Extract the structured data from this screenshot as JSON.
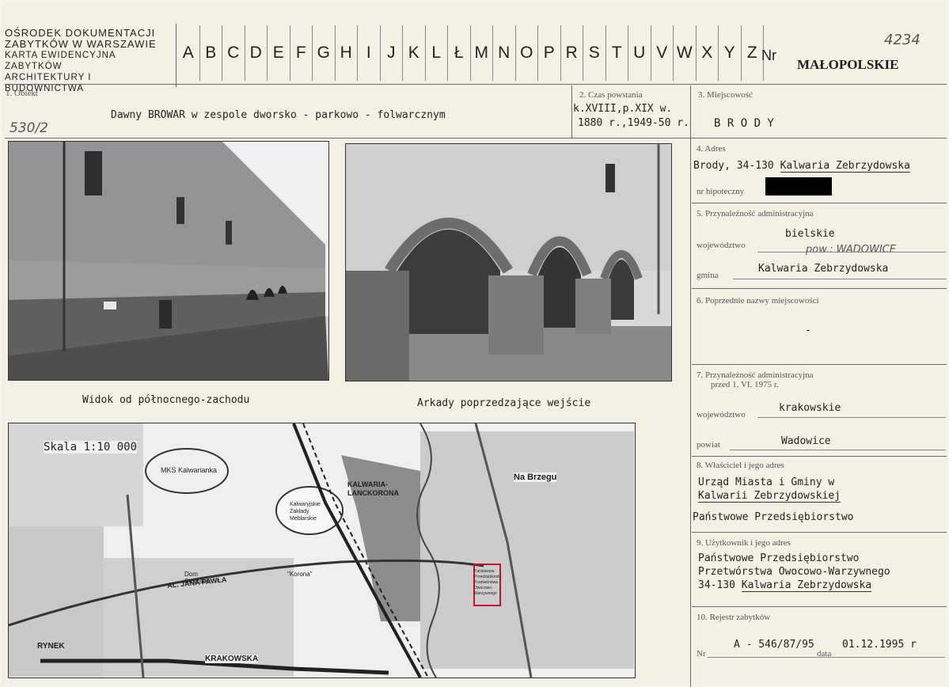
{
  "header": {
    "institution_lines": [
      "OŚRODEK DOKUMENTACJI",
      "ZABYTKÓW W WARSZAWIE",
      "KARTA EWIDENCYJNA ZABYTKÓW",
      "ARCHITEKTURY I BUDOWNICTWA"
    ],
    "letters": [
      "A",
      "B",
      "C",
      "D",
      "E",
      "F",
      "G",
      "H",
      "I",
      "J",
      "K",
      "L",
      "Ł",
      "M",
      "N",
      "O",
      "P",
      "R",
      "S",
      "T",
      "U",
      "V",
      "W",
      "X",
      "Y",
      "Z"
    ],
    "nr_label": "Nr",
    "nr_value": "4234",
    "region": "MAŁOPOLSKIE"
  },
  "object": {
    "label": "1. Obiekt",
    "value": "Dawny BROWAR w zespole dworsko - parkowo - folwarcznym",
    "hand_note": "530/2"
  },
  "time": {
    "label": "2. Czas powstania",
    "line1": "k.XVIII,p.XIX w.",
    "line2": "1880 r.,1949-50 r."
  },
  "place": {
    "label": "3. Miejscowość",
    "value": "B R O D Y"
  },
  "address": {
    "label": "4. Adres",
    "value_prefix": "Brody, 34-130 ",
    "value_underlined": "Kalwaria Zebrzydowska",
    "hipoteczny_label": "nr hipoteczny"
  },
  "admin": {
    "label": "5. Przynależność administracyjna",
    "woj_label": "województwo",
    "woj_value": "bielskie",
    "hand_note": "pow.: WADOWICE",
    "gmina_label": "gmina",
    "gmina_value": "Kalwaria Zebrzydowska"
  },
  "prev_names": {
    "label": "6. Poprzednie nazwy miejscowości",
    "value": "-"
  },
  "admin_before": {
    "label_line1": "7. Przynależność administracyjna",
    "label_line2": "przed 1. VI. 1975 r.",
    "woj_label": "województwo",
    "woj_value": "krakowskie",
    "powiat_label": "powiat",
    "powiat_value": "Wadowice"
  },
  "owner": {
    "label": "8. Właściciel i jego adres",
    "line1": "Urząd Miasta i Gminy w",
    "line2": "Kalwarii Zebrzydowskiej",
    "line3": "Państwowe Przedsiębiorstwo"
  },
  "user": {
    "label": "9. Użytkownik i jego adres",
    "line1": "Państwowe Przedsiębiorstwo",
    "line2": "Przetwórstwa Owocowo-Warzywnego",
    "line3_prefix": "34-130 ",
    "line3_underlined": "Kalwaria Zebrzydowska"
  },
  "register": {
    "label": "10. Rejestr zabytków",
    "nr_label": "Nr",
    "nr_value": "A - 546/87/95",
    "data_label": "data",
    "date_value": "01.12.1995 r"
  },
  "photos": {
    "caption_left": "Widok od północnego-zachodu",
    "caption_right": "Arkady poprzedzające wejście"
  },
  "map": {
    "scale": "Skala 1:10 000",
    "labels": {
      "kalwarianka": "MKS Kalwarianka",
      "station": "KALWARIA-LANCKORONA",
      "na_brzegu": "Na Brzegu",
      "zaklady": "Kalwaryjskie Zakłady Meblarskie",
      "street_jana_pawla": "AL. JANA PAWŁA",
      "street_krakowska": "KRAKOWSKA",
      "rynek": "RYNEK",
      "korona": "\"Korona\"",
      "dom_strazacki": "Dom Strażacki",
      "przedsiebiorstwo": "Państwowe Przedsiębiorstwo Przetwórstwa Owocowo-Warzywnego"
    }
  },
  "colors": {
    "card": "#f3f1e4",
    "ink": "#1e1e1e",
    "rule": "#6a6a6a",
    "highlight": "#c8102e"
  }
}
